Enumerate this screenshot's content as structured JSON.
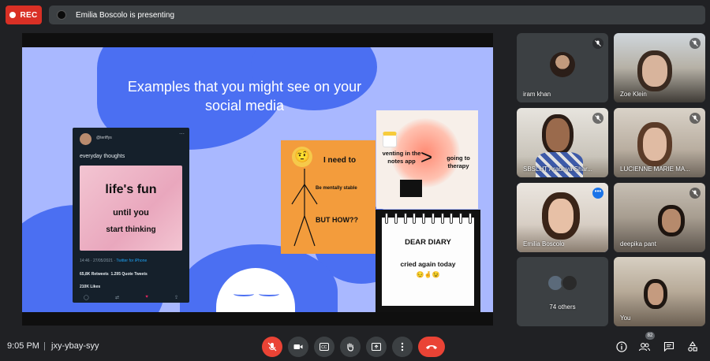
{
  "topbar": {
    "rec_label": "REC",
    "presenting_text": "Emilia Boscolo is presenting"
  },
  "slide": {
    "title": "Examples that you might see on your social media",
    "tweet": {
      "handle": "@teriffys",
      "text": "everyday thoughts",
      "image_line1": "life's fun",
      "image_line2": "until you",
      "image_line3": "start thinking",
      "meta_time": "14:46 · 27/05/2021 · ",
      "meta_source": "Twitter for iPhone",
      "retweets": "65,8K Retweets",
      "quote_tweets": "1.295 Quote Tweets",
      "likes": "210K Likes"
    },
    "meme_need": {
      "line1": "I need to",
      "line2": "Be mentally stable",
      "line3": "BUT HOW??"
    },
    "meme_notes": {
      "left": "venting in the notes app",
      "symbol": ">",
      "right": "going to therapy"
    },
    "meme_diary": {
      "line1": "DEAR DIARY",
      "line2": "cried again today"
    }
  },
  "participants": [
    {
      "name": "iram khan",
      "muted": true
    },
    {
      "name": "Zoe Klein",
      "muted": true
    },
    {
      "name": "SBSLHT Aradhya Shar...",
      "muted": true
    },
    {
      "name": "LUCIENNE MARIE MA...",
      "muted": true
    },
    {
      "name": "Emilia Boscolo",
      "muted": false,
      "speaking": true
    },
    {
      "name": "deepika pant",
      "muted": true
    },
    {
      "name": "74 others",
      "muted": false
    },
    {
      "name": "You",
      "muted": false
    }
  ],
  "bottombar": {
    "time": "9:05 PM",
    "separator": "|",
    "meeting_code": "jxy-ybay-syy",
    "people_count": "82"
  },
  "colors": {
    "accent": "#1a73e8",
    "danger": "#ea4335",
    "bg": "#202124",
    "surface": "#3c4043",
    "slide_bg": "#a9b8ff"
  }
}
